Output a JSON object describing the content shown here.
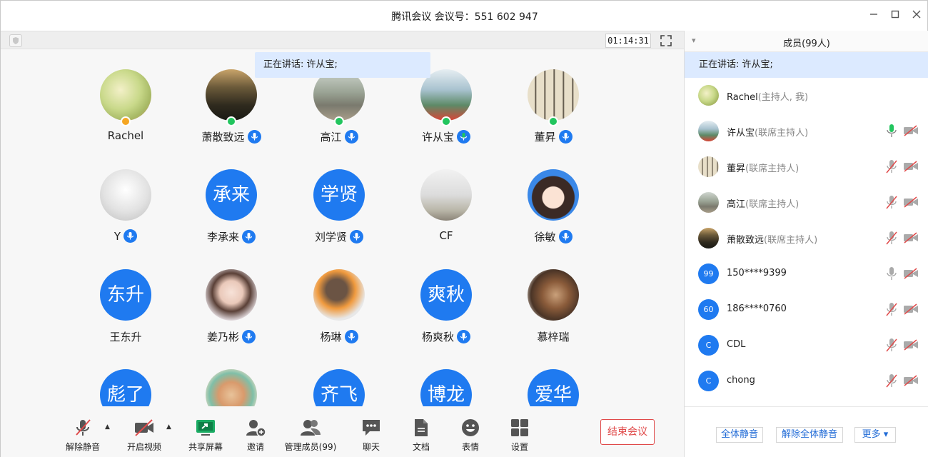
{
  "window": {
    "title": "腾讯会议 会议号：551 602 947"
  },
  "topbar": {
    "timer": "01:14:31"
  },
  "speaking": "正在讲话: 许从宝;",
  "participants": [
    {
      "name": "Rachel",
      "avatar_text": ""
    },
    {
      "name": "萧散致远",
      "avatar_text": ""
    },
    {
      "name": "高江",
      "avatar_text": ""
    },
    {
      "name": "许从宝",
      "avatar_text": ""
    },
    {
      "name": "董昇",
      "avatar_text": ""
    },
    {
      "name": "Y",
      "avatar_text": ""
    },
    {
      "name": "李承来",
      "avatar_text": "承来"
    },
    {
      "name": "刘学贤",
      "avatar_text": "学贤"
    },
    {
      "name": "CF",
      "avatar_text": ""
    },
    {
      "name": "徐敏",
      "avatar_text": ""
    },
    {
      "name": "王东升",
      "avatar_text": "东升"
    },
    {
      "name": "姜乃彬",
      "avatar_text": ""
    },
    {
      "name": "杨琳",
      "avatar_text": ""
    },
    {
      "name": "杨爽秋",
      "avatar_text": "爽秋"
    },
    {
      "name": "慕梓瑞",
      "avatar_text": ""
    },
    {
      "name": "",
      "avatar_text": "彪了"
    },
    {
      "name": "",
      "avatar_text": ""
    },
    {
      "name": "",
      "avatar_text": "齐飞"
    },
    {
      "name": "",
      "avatar_text": "博龙"
    },
    {
      "name": "",
      "avatar_text": "爱华"
    }
  ],
  "controls": {
    "unmute": "解除静音",
    "video": "开启视频",
    "share": "共享屏幕",
    "invite": "邀请",
    "manage": "管理成员(99)",
    "chat": "聊天",
    "docs": "文档",
    "emoji": "表情",
    "settings": "设置",
    "end": "结束会议"
  },
  "members": {
    "title": "成员(99人)",
    "speaking": "正在讲话: 许从宝;",
    "list": [
      {
        "name": "Rachel",
        "role": "(主持人, 我)",
        "avatar_text": ""
      },
      {
        "name": "许从宝",
        "role": "(联席主持人)",
        "avatar_text": ""
      },
      {
        "name": "董昇",
        "role": "(联席主持人)",
        "avatar_text": ""
      },
      {
        "name": "高江",
        "role": "(联席主持人)",
        "avatar_text": ""
      },
      {
        "name": "萧散致远",
        "role": "(联席主持人)",
        "avatar_text": ""
      },
      {
        "name": "150****9399",
        "role": "",
        "avatar_text": "99"
      },
      {
        "name": "186****0760",
        "role": "",
        "avatar_text": "60"
      },
      {
        "name": "CDL",
        "role": "",
        "avatar_text": "C"
      },
      {
        "name": "chong",
        "role": "",
        "avatar_text": "C"
      }
    ],
    "mute_all": "全体静音",
    "unmute_all": "解除全体静音",
    "more": "更多"
  },
  "colors": {
    "accent": "#1f7af0",
    "speaking_bg": "#dceaff",
    "end": "#e04a4a",
    "mic_active": "#22c55e"
  }
}
